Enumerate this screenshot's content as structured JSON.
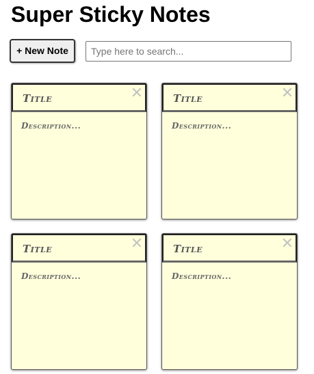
{
  "app": {
    "title": "Super Sticky Notes"
  },
  "toolbar": {
    "new_note_label": "+ New Note",
    "search_placeholder": "Type here to search...",
    "search_value": ""
  },
  "notes": [
    {
      "title": "Title",
      "description": "Description...",
      "close_icon": "close-icon"
    },
    {
      "title": "Title",
      "description": "Description...",
      "close_icon": "close-icon"
    },
    {
      "title": "Title",
      "description": "Description...",
      "close_icon": "close-icon"
    },
    {
      "title": "Title",
      "description": "Description...",
      "close_icon": "close-icon"
    }
  ],
  "colors": {
    "note_background": "#ffffdc",
    "note_border": "#555555",
    "close_icon": "#c4c4c4"
  }
}
